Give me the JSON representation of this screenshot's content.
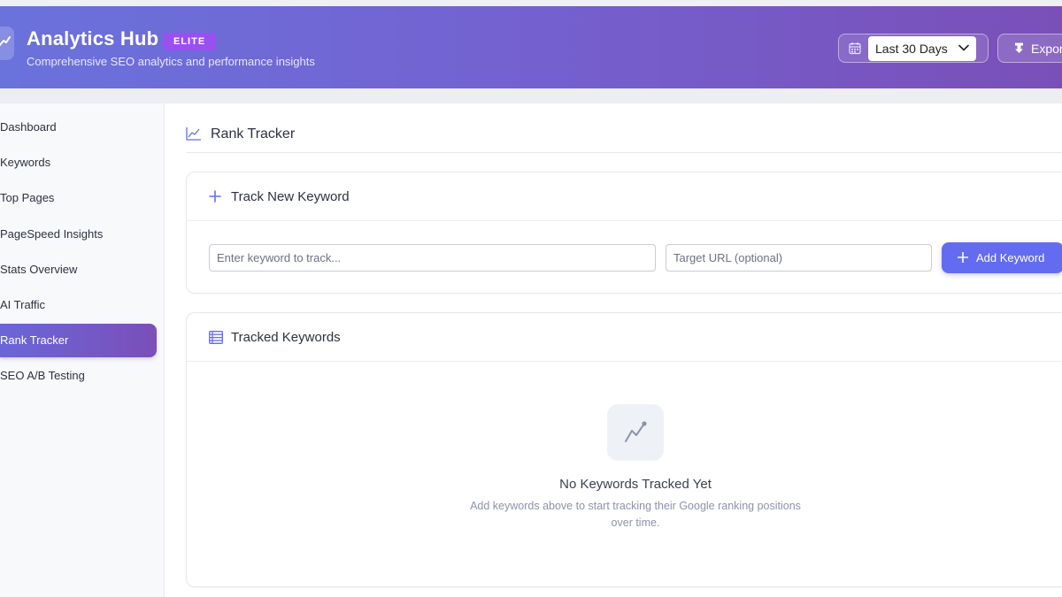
{
  "header": {
    "title": "Analytics Hub",
    "badge": "ELITE",
    "subtitle": "Comprehensive SEO analytics and performance insights",
    "date_range": "Last 30 Days",
    "export_label": "Export"
  },
  "sidebar": {
    "items": [
      {
        "label": "Dashboard",
        "active": false
      },
      {
        "label": "Keywords",
        "active": false
      },
      {
        "label": "Top Pages",
        "active": false
      },
      {
        "label": "PageSpeed Insights",
        "active": false
      },
      {
        "label": "Stats Overview",
        "active": false
      },
      {
        "label": "AI Traffic",
        "active": false
      },
      {
        "label": "Rank Tracker",
        "active": true
      },
      {
        "label": "SEO A/B Testing",
        "active": false
      }
    ]
  },
  "main": {
    "title": "Rank Tracker",
    "track_card": {
      "title": "Track New Keyword",
      "keyword_placeholder": "Enter keyword to track...",
      "keyword_value": "",
      "url_placeholder": "Target URL (optional)",
      "url_value": "",
      "add_label": "Add Keyword"
    },
    "tracked_card": {
      "title": "Tracked Keywords",
      "empty_title": "No Keywords Tracked Yet",
      "empty_text": "Add keywords above to start tracking their Google ranking positions over time."
    }
  },
  "colors": {
    "header_gradient_start": "#6a72dc",
    "header_gradient_end": "#7a4fb8",
    "badge": "#9b4ff0",
    "primary_button": "#636cf0",
    "active_nav_start": "#6b66d8",
    "active_nav_end": "#7a4fb8"
  },
  "icons": {
    "logo": "chart-line-icon",
    "calendar": "calendar-icon",
    "dropdown": "chevron-down-icon",
    "export": "download-icon",
    "section": "chart-line-icon",
    "track_new": "plus-icon",
    "tracked": "list-icon",
    "empty_state": "chart-line-icon"
  }
}
